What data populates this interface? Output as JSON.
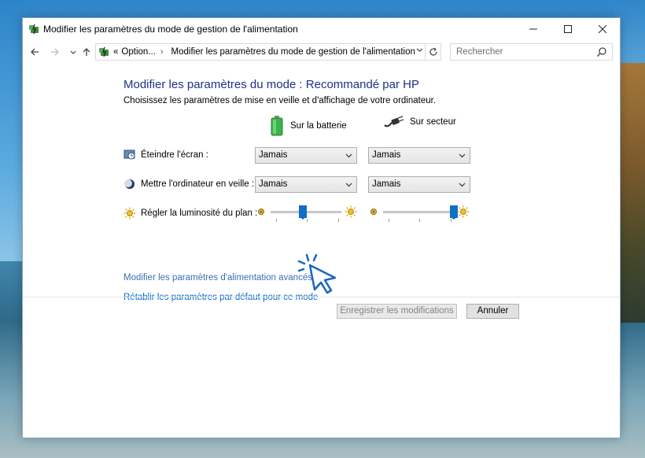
{
  "window": {
    "title": "Modifier les paramètres du mode de gestion de l'alimentation",
    "minimize_icon": "minimize-icon",
    "maximize_icon": "maximize-icon",
    "close_icon": "close-icon"
  },
  "nav": {
    "address_prefix": "«",
    "address_part1": "Option...",
    "address_separator": "›",
    "address_part2": "Modifier les paramètres du mode de gestion de l'alimentation",
    "search_placeholder": "Rechercher"
  },
  "main": {
    "heading": "Modifier les paramètres du mode : Recommandé par HP",
    "subheading": "Choisissez les paramètres de mise en veille et d'affichage de votre ordinateur.",
    "col_battery": "Sur la batterie",
    "col_sector": "Sur secteur",
    "rows": [
      {
        "label": "Éteindre l'écran :",
        "battery": "Jamais",
        "sector": "Jamais"
      },
      {
        "label": "Mettre l'ordinateur en veille :",
        "battery": "Jamais",
        "sector": "Jamais"
      }
    ],
    "brightness_label": "Régler la luminosité du plan :",
    "brightness_battery": 0.45,
    "brightness_sector": 1.0
  },
  "links": {
    "advanced": "Modifier les paramètres d'alimentation avancés",
    "restore": "Rétablir les paramètres par défaut pour ce mode"
  },
  "buttons": {
    "save": "Enregistrer les modifications",
    "cancel": "Annuler"
  },
  "colors": {
    "heading": "#1e3287",
    "link": "#0066cc",
    "slider_thumb": "#0f6fc6"
  }
}
